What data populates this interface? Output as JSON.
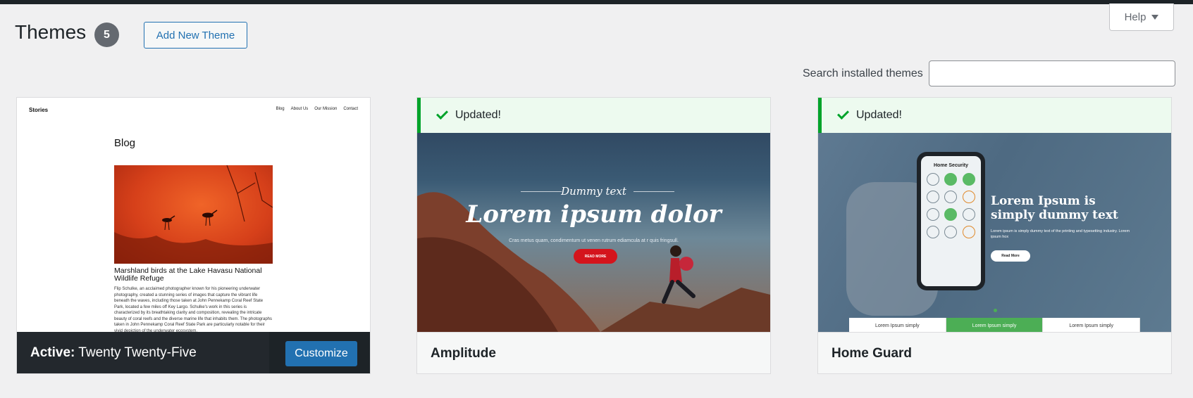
{
  "header": {
    "title": "Themes",
    "count": "5",
    "add_new_label": "Add New Theme",
    "help_label": "Help"
  },
  "search": {
    "label": "Search installed themes",
    "value": "",
    "placeholder": ""
  },
  "themes": [
    {
      "active": true,
      "active_prefix": "Active:",
      "name": "Twenty Twenty-Five",
      "customize_label": "Customize",
      "preview": {
        "site_title": "Stories",
        "nav": [
          "Blog",
          "About Us",
          "Our Mission",
          "Contact"
        ],
        "page_heading": "Blog",
        "post_title": "Marshland birds at the Lake Havasu National Wildlife Refuge",
        "post_excerpt": "Flip Schulke, an acclaimed photographer known for his pioneering underwater photography, created a stunning series of images that capture the vibrant life beneath the waves, including those taken at John Pennekamp Coral Reef State Park, located a few miles off Key Largo. Schulke's work in this series is characterized by its breathtaking clarity and composition, revealing the intricate beauty of coral reefs and the diverse marine life that inhabits them. The photographs taken in John Pennekamp Coral Reef State Park are particularly notable for their vivid depiction of the underwater ecosystem."
      }
    },
    {
      "active": false,
      "name": "Amplitude",
      "notice": "Updated!",
      "preview": {
        "eyebrow": "Dummy text",
        "headline": "Lorem ipsum dolor",
        "subtext": "Cras metus quam, condimentum ut venen rutrum ediamcula at r quis fringsull.",
        "button": "READ MORE"
      }
    },
    {
      "active": false,
      "name": "Home Guard",
      "notice": "Updated!",
      "preview": {
        "screen_title": "Home Security",
        "headline": "Lorem Ipsum is simply dummy text",
        "subtext": "Lorem ipsum is simply dummy text of the printing and typesetting industry. Lorem ipsum hox",
        "button": "Read More",
        "cards": [
          "Lorem Ipsum simply",
          "Lorem Ipsum simply",
          "Lorem Ipsum simply"
        ]
      }
    }
  ],
  "colors": {
    "accent": "#2271b1",
    "success": "#00a32a",
    "adminbar": "#1d2327"
  }
}
